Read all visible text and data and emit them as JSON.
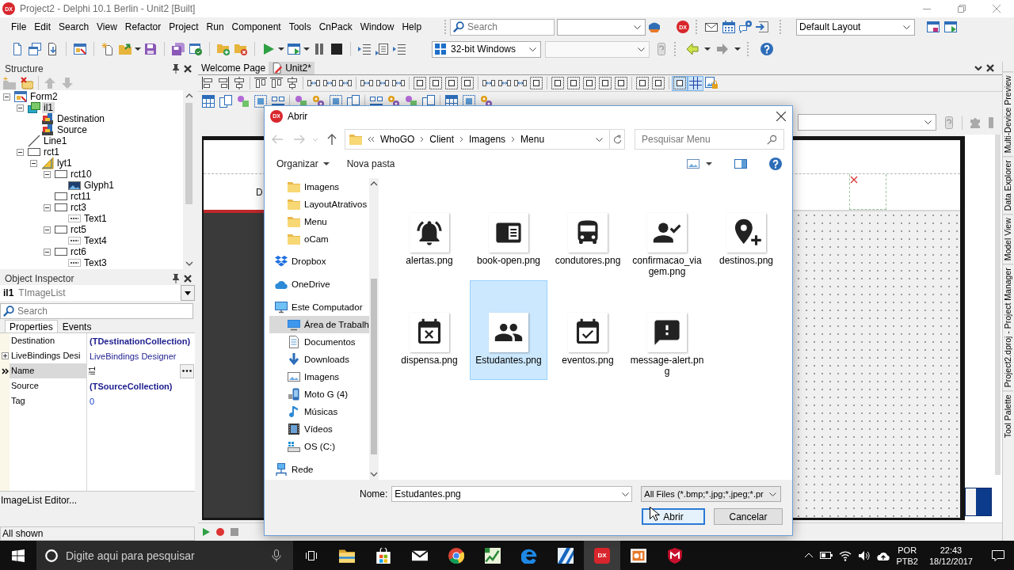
{
  "window": {
    "logo": "DX",
    "title": "Project2 - Delphi 10.1 Berlin - Unit2 [Built]"
  },
  "menu": [
    "File",
    "Edit",
    "Search",
    "View",
    "Refactor",
    "Project",
    "Run",
    "Component",
    "Tools",
    "CnPack",
    "Window",
    "Help"
  ],
  "toolbar": {
    "search": {
      "placeholder": "Search"
    },
    "logo": "DX",
    "layout": "Default Layout",
    "platform": "32-bit Windows"
  },
  "structure": {
    "title": "Structure",
    "tree": [
      {
        "label": "Form2",
        "kind": "form",
        "expanded": true,
        "selected": false,
        "children": [
          {
            "label": "il1",
            "kind": "imagelist",
            "expanded": true,
            "selected": true,
            "children": [
              {
                "label": "Destination",
                "kind": "collection",
                "selected": false
              },
              {
                "label": "Source",
                "kind": "collection",
                "selected": false
              }
            ]
          },
          {
            "label": "Line1",
            "kind": "line",
            "selected": false
          },
          {
            "label": "rct1",
            "kind": "rectangle",
            "expanded": true,
            "selected": false,
            "children": [
              {
                "label": "lyt1",
                "kind": "layout",
                "expanded": true,
                "selected": false,
                "children": [
                  {
                    "label": "rct10",
                    "kind": "rectangle",
                    "expanded": true,
                    "selected": false,
                    "children": [
                      {
                        "label": "Glyph1",
                        "kind": "glyph",
                        "selected": false
                      }
                    ]
                  },
                  {
                    "label": "rct11",
                    "kind": "rectangle",
                    "selected": false
                  },
                  {
                    "label": "rct3",
                    "kind": "rectangle",
                    "expanded": true,
                    "selected": false,
                    "children": [
                      {
                        "label": "Text1",
                        "kind": "text",
                        "selected": false
                      }
                    ]
                  },
                  {
                    "label": "rct5",
                    "kind": "rectangle",
                    "expanded": true,
                    "selected": false,
                    "children": [
                      {
                        "label": "Text4",
                        "kind": "text",
                        "selected": false
                      }
                    ]
                  },
                  {
                    "label": "rct6",
                    "kind": "rectangle",
                    "expanded": true,
                    "selected": false,
                    "children": [
                      {
                        "label": "Text3",
                        "kind": "text",
                        "selected": false
                      }
                    ]
                  }
                ]
              }
            ]
          }
        ]
      }
    ]
  },
  "object_inspector": {
    "title": "Object Inspector",
    "object_name": "il1",
    "object_type": "TImageList",
    "search": {
      "placeholder": "Search"
    },
    "tabs": [
      {
        "label": "Properties",
        "selected": true
      },
      {
        "label": "Events",
        "selected": false
      }
    ],
    "properties": [
      {
        "name": "Destination",
        "value": "(TDestinationCollection)",
        "kind": "collection",
        "selected": false
      },
      {
        "name": "LiveBindings Desi",
        "value": "LiveBindings Designer",
        "kind": "group",
        "expanded": false,
        "selected": false
      },
      {
        "name": "Name",
        "value": "il1",
        "kind": "text",
        "selected": true
      },
      {
        "name": "Source",
        "value": "(TSourceCollection)",
        "kind": "collection",
        "selected": false
      },
      {
        "name": "Tag",
        "value": "0",
        "kind": "number",
        "selected": false
      }
    ],
    "editor_link": "ImageList Editor..."
  },
  "status_bar": "All shown",
  "editor": {
    "tabs": [
      {
        "label": "Welcome Page",
        "kind": "page",
        "selected": false
      },
      {
        "label": "Unit2*",
        "kind": "unit",
        "selected": true
      }
    ],
    "design_toolbar": [
      {
        "pressed": false
      },
      {
        "pressed": false
      },
      {
        "pressed": false
      },
      {
        "pressed": false
      },
      {
        "pressed": false
      },
      {
        "pressed": false
      },
      {
        "pressed": false
      },
      {
        "pressed": false
      },
      {
        "pressed": false
      },
      {
        "pressed": false
      },
      {
        "pressed": false
      },
      {
        "pressed": false
      },
      {
        "pressed": false
      },
      {
        "pressed": false
      },
      {
        "pressed": false
      },
      {
        "pressed": false
      },
      {
        "pressed": false
      },
      {
        "pressed": false
      },
      {
        "pressed": false
      },
      {
        "pressed": false
      },
      {
        "pressed": false
      },
      {
        "pressed": false
      },
      {
        "pressed": false
      },
      {
        "pressed": false
      },
      {
        "pressed": false
      },
      {
        "pressed": false
      },
      {
        "pressed": false
      },
      {
        "pressed": true
      },
      {
        "pressed": true
      },
      {
        "pressed": false
      }
    ],
    "form_label": "D"
  },
  "side_tabs": [
    "Tool Palette",
    "Project2.dproj - Project Manager",
    "Model View",
    "Data Explorer",
    "Multi-Device Preview"
  ],
  "dialog": {
    "logo": "DX",
    "title": "Abrir",
    "path": [
      "WhoGO",
      "Client",
      "Imagens",
      "Menu"
    ],
    "search": {
      "placeholder": "Pesquisar Menu"
    },
    "organize": "Organizar",
    "new_folder": "Nova pasta",
    "quick_access": [
      {
        "label": "Imagens",
        "selected": false
      },
      {
        "label": "LayoutAtrativos",
        "selected": false
      },
      {
        "label": "Menu",
        "selected": false
      },
      {
        "label": "oCam",
        "selected": false
      }
    ],
    "locations": [
      {
        "label": "Dropbox",
        "kind": "dropbox",
        "selected": false
      },
      {
        "label": "OneDrive",
        "kind": "cloud",
        "selected": false
      },
      {
        "label": "Este Computador",
        "kind": "computer",
        "selected": false,
        "children": [
          {
            "label": "Área de Trabalh",
            "kind": "desktop",
            "selected": true
          },
          {
            "label": "Documentos",
            "kind": "documents",
            "selected": false
          },
          {
            "label": "Downloads",
            "kind": "downloads",
            "selected": false
          },
          {
            "label": "Imagens",
            "kind": "pictures",
            "selected": false
          },
          {
            "label": "Moto G (4)",
            "kind": "phone",
            "selected": false
          },
          {
            "label": "Músicas",
            "kind": "music",
            "selected": false
          },
          {
            "label": "Vídeos",
            "kind": "videos",
            "selected": false
          },
          {
            "label": "OS (C:)",
            "kind": "drive",
            "selected": false
          }
        ]
      },
      {
        "label": "Rede",
        "kind": "network",
        "selected": false
      }
    ],
    "files": [
      {
        "name": "alertas.png",
        "kind": "bell",
        "selected": false
      },
      {
        "name": "book-open.png",
        "kind": "book",
        "selected": false
      },
      {
        "name": "condutores.png",
        "kind": "bus",
        "selected": false
      },
      {
        "name": "confirmacao_viagem.png",
        "kind": "person-check",
        "selected": false
      },
      {
        "name": "destinos.png",
        "kind": "pin-plus",
        "selected": false
      },
      {
        "name": "dispensa.png",
        "kind": "calendar-x",
        "selected": false
      },
      {
        "name": "Estudantes.png",
        "kind": "group",
        "selected": true
      },
      {
        "name": "eventos.png",
        "kind": "calendar-check",
        "selected": false
      },
      {
        "name": "message-alert.png",
        "kind": "message-alert",
        "selected": false
      }
    ],
    "filename": {
      "label": "Nome:",
      "value": "Estudantes.png"
    },
    "filter": "All Files (*.bmp;*.jpg;*.jpeg;*.pr",
    "buttons": [
      {
        "label": "Abrir",
        "kind": "default"
      },
      {
        "label": "Cancelar",
        "kind": "normal"
      }
    ]
  },
  "taskbar": {
    "search": {
      "placeholder": "Digite aqui para pesquisar"
    },
    "apps": [
      {
        "kind": "folder",
        "selected": false
      },
      {
        "kind": "bag",
        "selected": false
      },
      {
        "kind": "envelope",
        "selected": false
      },
      {
        "kind": "wheel",
        "selected": false
      },
      {
        "kind": "chart",
        "selected": false
      },
      {
        "kind": "swirl",
        "selected": false
      },
      {
        "kind": "film",
        "selected": false
      },
      {
        "kind": "logo",
        "logo": "DX",
        "selected": true
      },
      {
        "kind": "slides",
        "selected": false
      },
      {
        "kind": "shield",
        "selected": false
      }
    ],
    "language": "POR",
    "layout": "PTB2",
    "time": "22:43",
    "date": "18/12/2017"
  }
}
